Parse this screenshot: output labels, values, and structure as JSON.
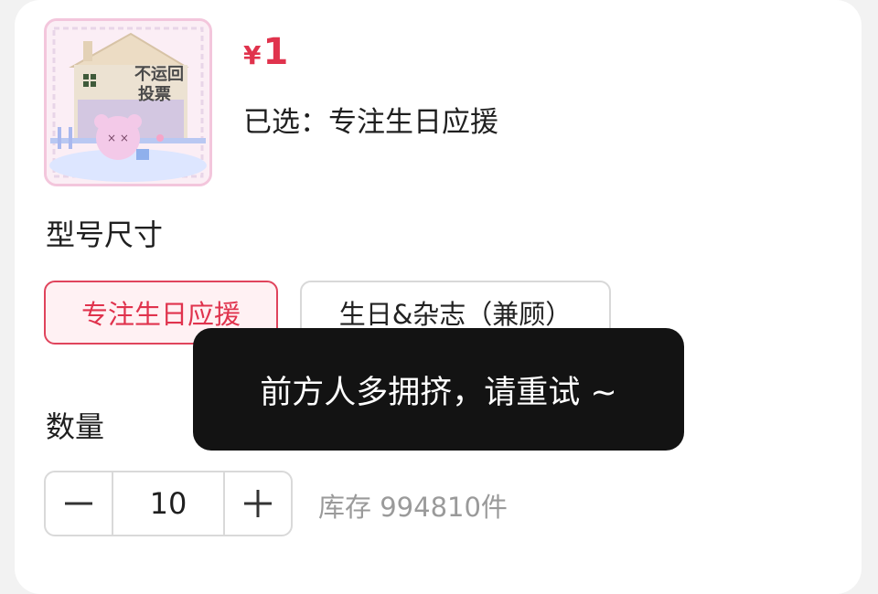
{
  "product": {
    "currency": "¥",
    "price": "1",
    "selected_prefix": "已选：",
    "selected_value": "专注生日应援",
    "thumbnail_text": "不运回 投票"
  },
  "variant": {
    "label": "型号尺寸",
    "options": [
      {
        "label": "专注生日应援",
        "selected": true
      },
      {
        "label": "生日&杂志（兼顾）",
        "selected": false
      }
    ]
  },
  "quantity": {
    "label": "数量",
    "value": "10",
    "minus_icon": "minus-icon",
    "plus_icon": "plus-icon",
    "stock_text": "库存 994810件"
  },
  "toast": {
    "message": "前方人多拥挤，请重试 ~"
  },
  "colors": {
    "accent": "#e0334d",
    "toast_bg": "#131313"
  }
}
